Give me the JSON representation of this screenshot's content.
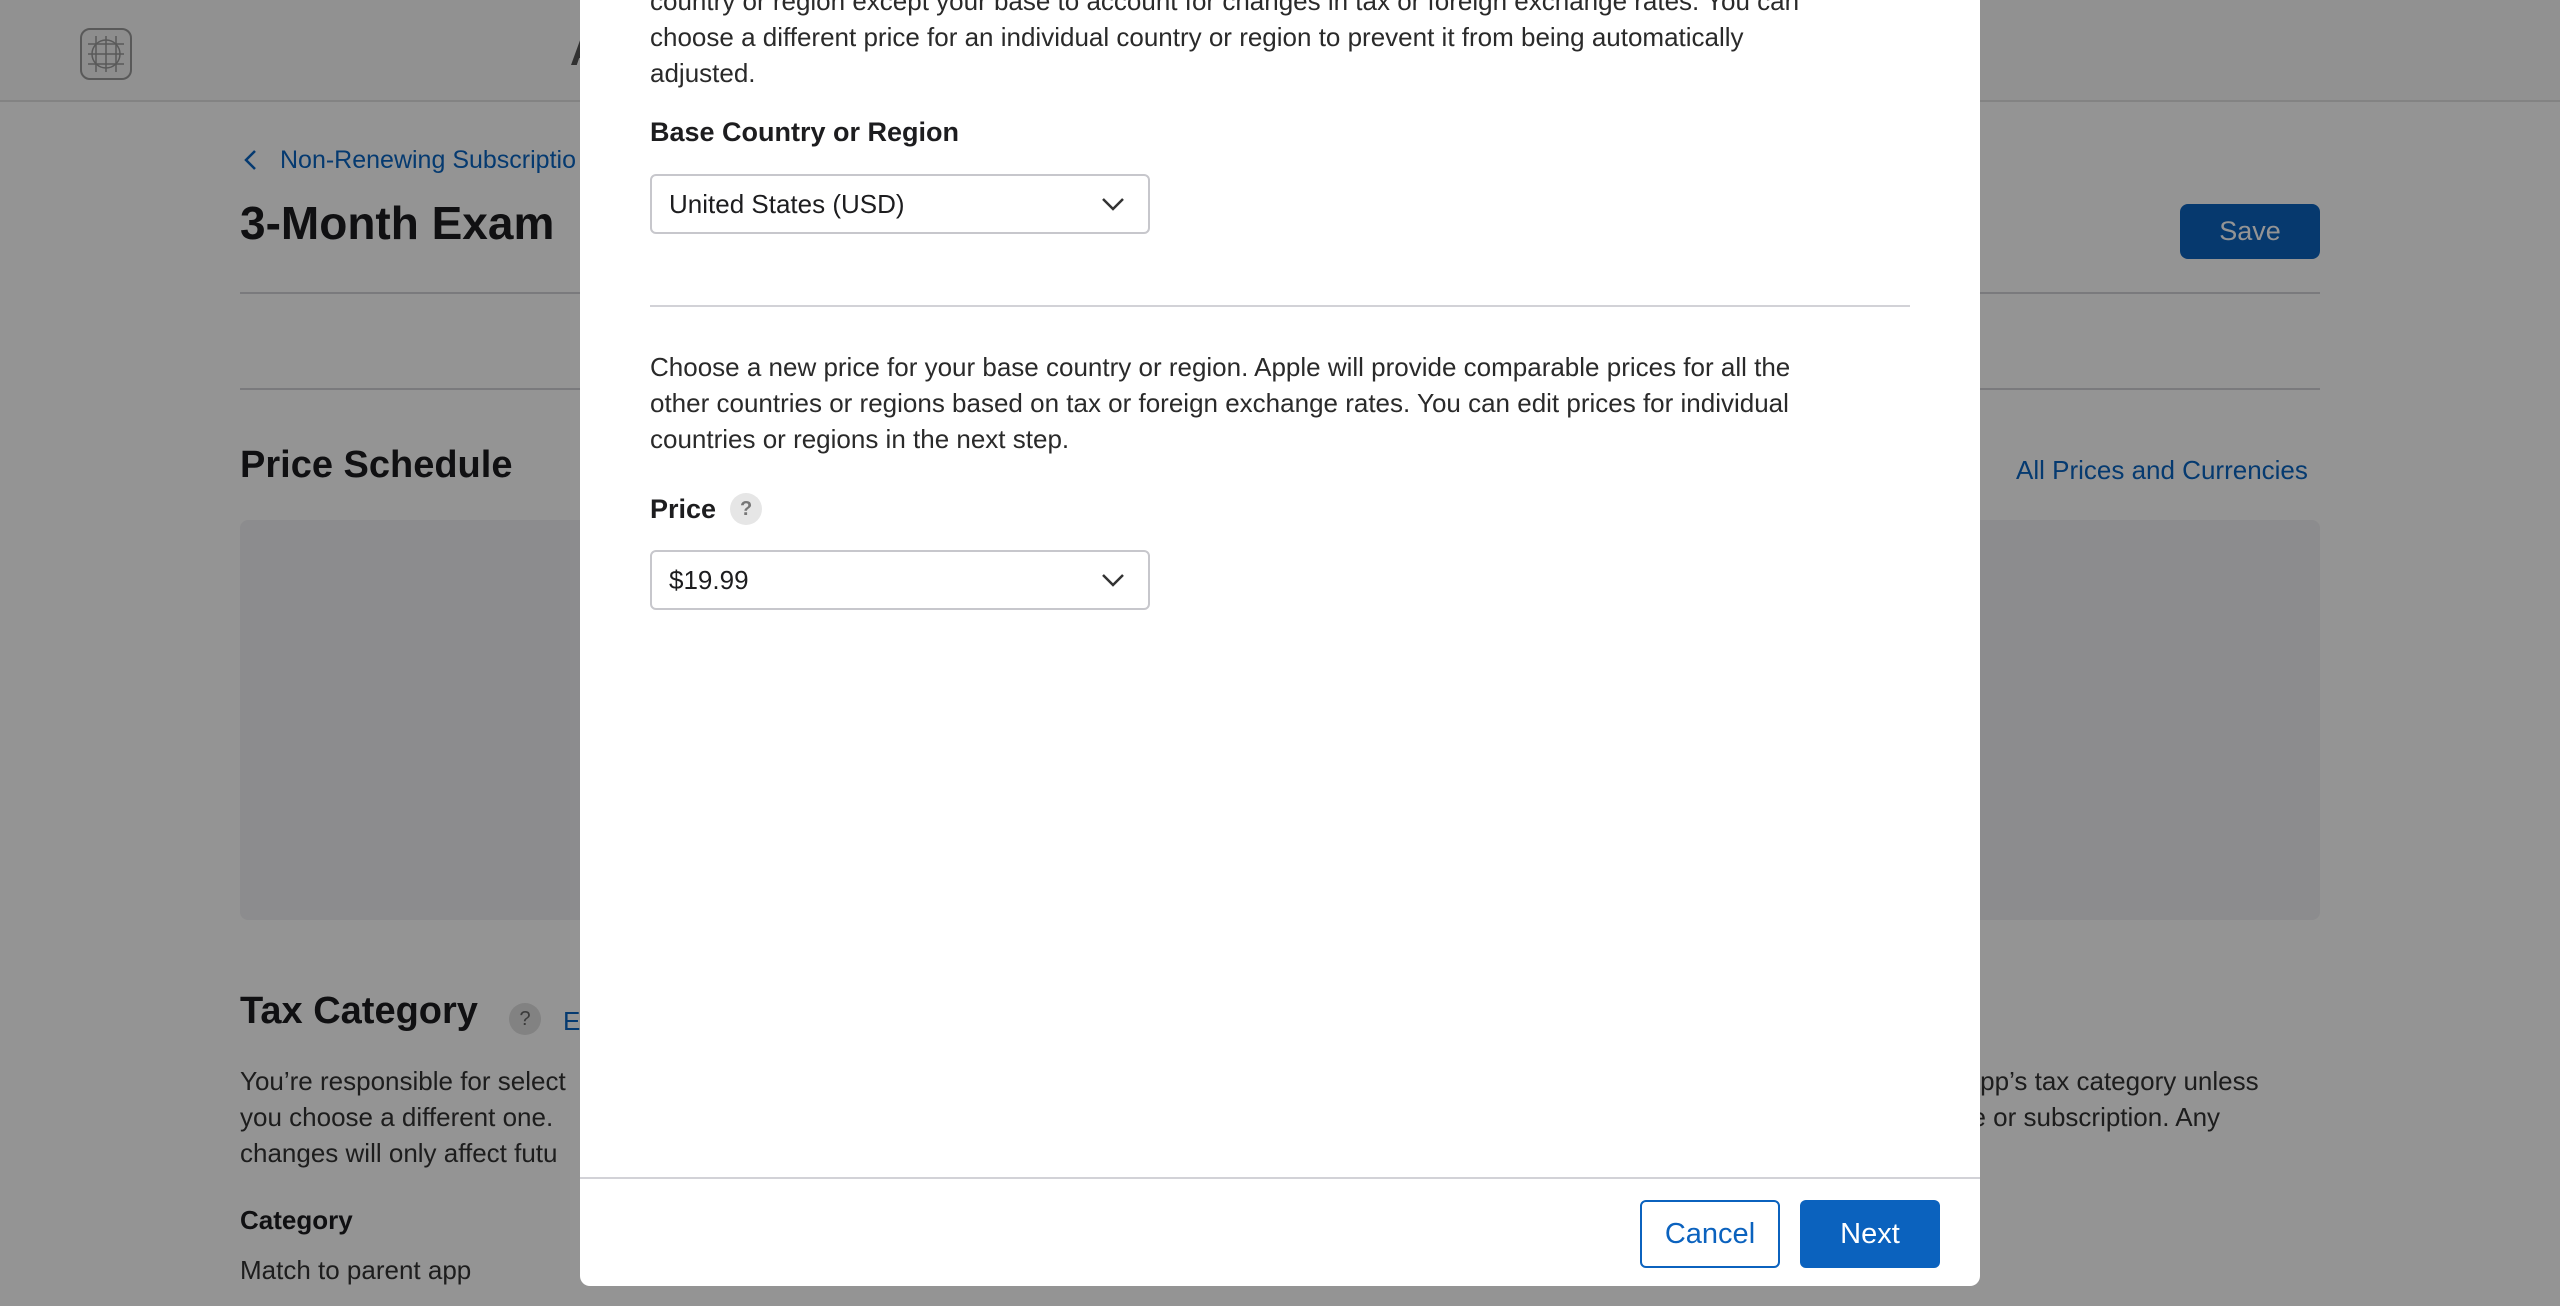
{
  "background": {
    "topbar_letter": "A",
    "breadcrumb": "Non-Renewing Subscriptio",
    "page_title": "3-Month Exam",
    "save_label": "Save",
    "price_schedule_title": "Price Schedule",
    "all_prices_link": "All Prices and Currencies",
    "tax_title": "Tax Category",
    "tax_edit_link": "E",
    "tax_text_left": [
      "You’re responsible for select",
      "you choose a different one.",
      "changes will only affect futu"
    ],
    "tax_text_right": [
      "e app’s tax category unless",
      "ase or subscription. Any"
    ],
    "category_label": "Category",
    "category_value": "Match to parent app"
  },
  "modal": {
    "intro_lines": [
      "country or region except your base to account for changes in tax or foreign exchange rates. You can",
      "choose a different price for an individual country or region to prevent it from being automatically",
      "adjusted."
    ],
    "base_country_label": "Base Country or Region",
    "base_country_value": "United States (USD)",
    "price_info_lines": [
      "Choose a new price for your base country or region. Apple will provide comparable prices for all the",
      "other countries or regions based on tax or foreign exchange rates. You can edit prices for individual",
      "countries or regions in the next step."
    ],
    "price_label": "Price",
    "help_symbol": "?",
    "price_value": "$19.99",
    "cancel_label": "Cancel",
    "next_label": "Next"
  },
  "colors": {
    "accent": "#0b62be",
    "link": "#0a65c2",
    "overlay": "rgba(0,0,0,0.42)"
  },
  "icons": [
    "app-logo-icon",
    "back-chevron-icon",
    "help-icon",
    "chevron-down-icon"
  ]
}
